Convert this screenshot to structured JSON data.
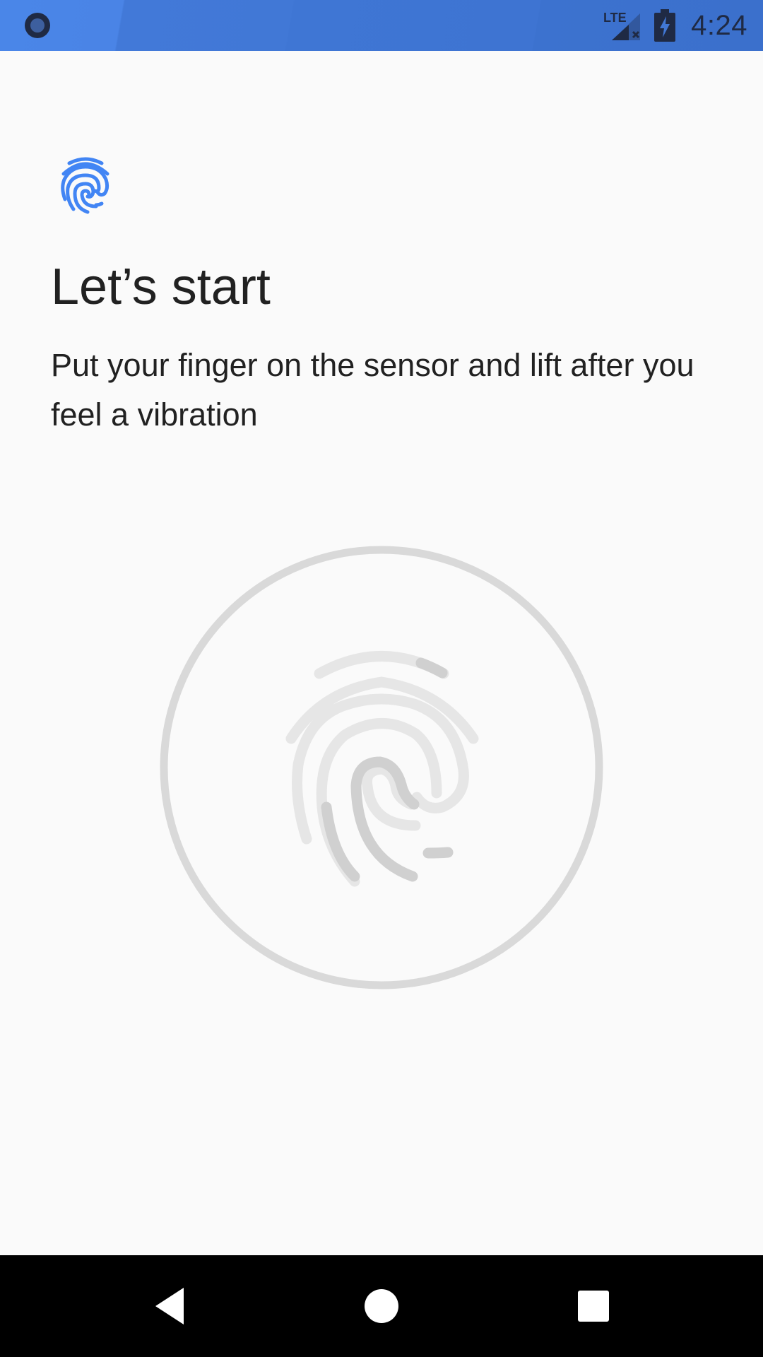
{
  "status_bar": {
    "network_label": "LTE",
    "time": "4:24",
    "background_color": "#4178d6",
    "icons": [
      "app-notification-icon",
      "lte-signal-icon",
      "battery-charging-icon"
    ]
  },
  "content": {
    "header_icon": "fingerprint-icon",
    "title": "Let’s start",
    "description": "Put your finger on the sensor and lift after you feel a vibration",
    "accent_color": "#4285f4",
    "sensor_graphic": "fingerprint-sensor-illustration"
  },
  "nav_bar": {
    "buttons": [
      "back-icon",
      "home-icon",
      "recents-icon"
    ]
  }
}
